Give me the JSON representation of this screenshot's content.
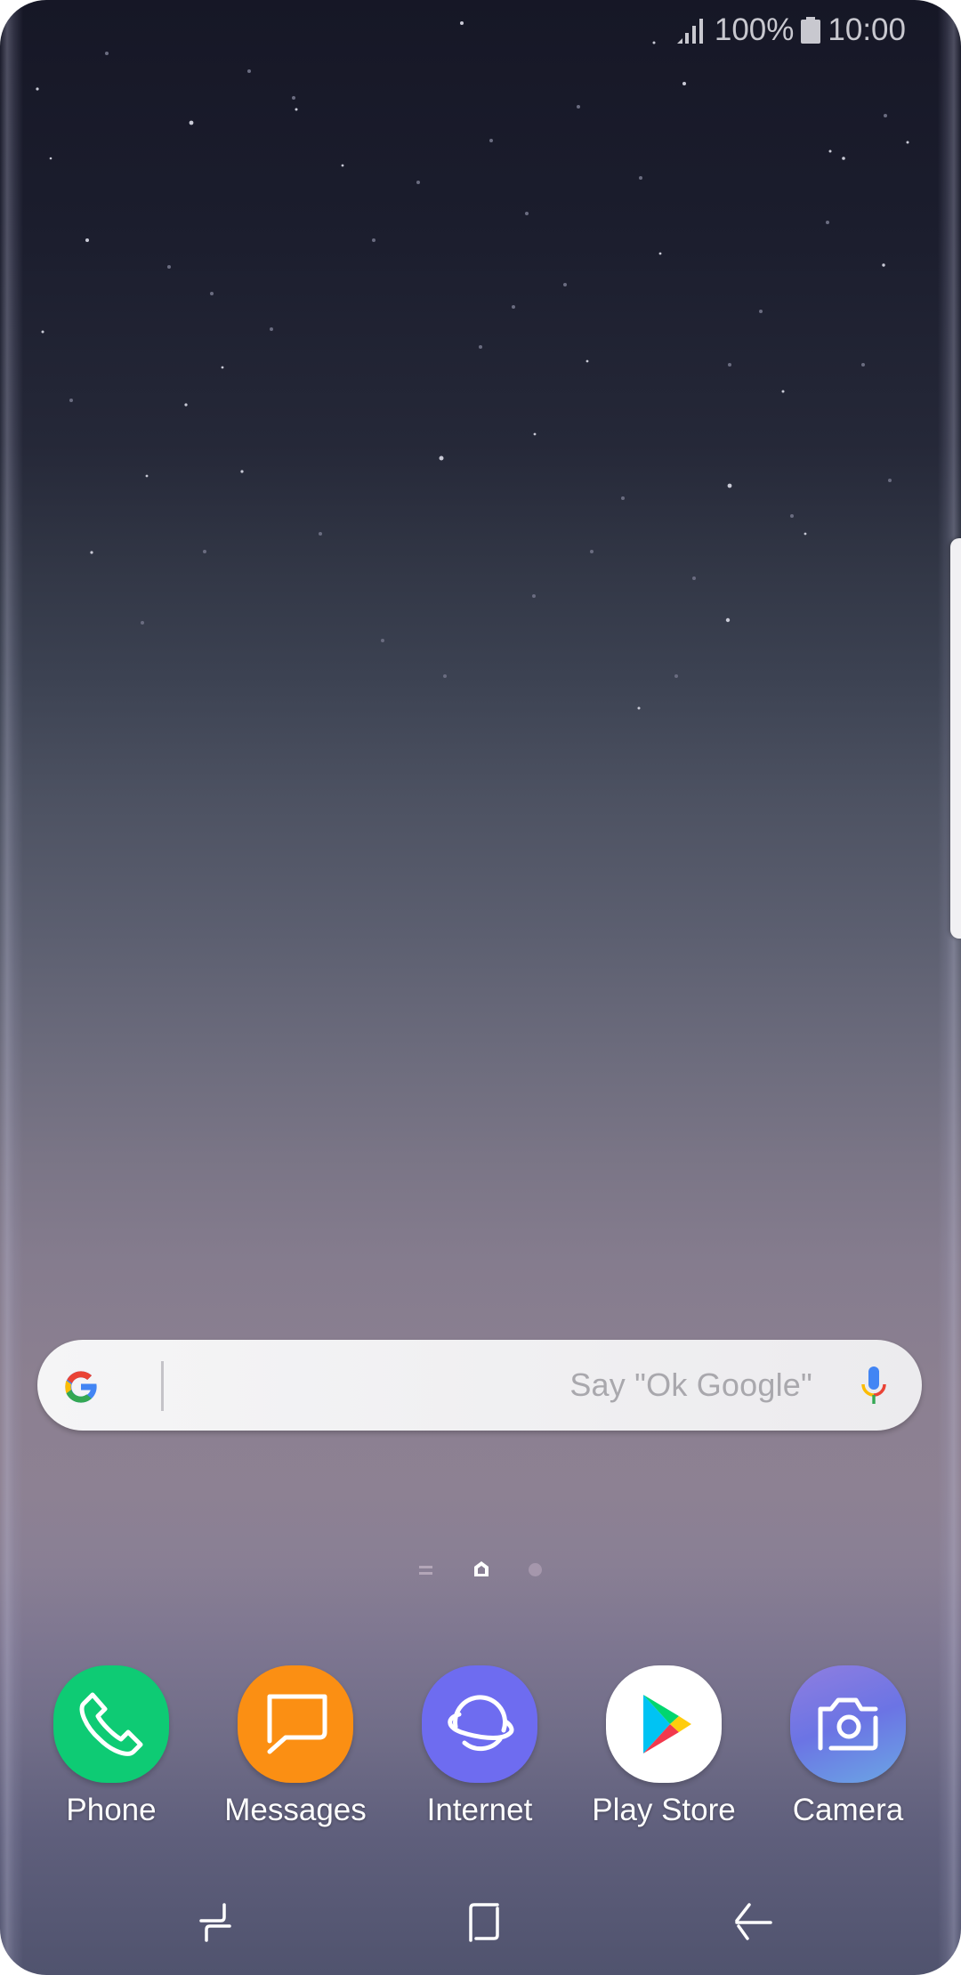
{
  "status_bar": {
    "signal_icon": "signal-strength-icon",
    "battery_percent": "100%",
    "battery_icon": "battery-icon",
    "time": "10:00"
  },
  "search_widget": {
    "logo_icon": "google-g-icon",
    "placeholder": "Say \"Ok Google\"",
    "mic_icon": "microphone-icon"
  },
  "page_indicator": {
    "items": [
      "list-page-icon",
      "home-page-icon",
      "page-dot"
    ],
    "current": "home"
  },
  "dock": {
    "apps": [
      {
        "label": "Phone",
        "icon": "phone-icon",
        "color": "#0ecb74"
      },
      {
        "label": "Messages",
        "icon": "message-bubble-icon",
        "color": "#fb8f13"
      },
      {
        "label": "Internet",
        "icon": "planet-icon",
        "color": "#6e6cf0"
      },
      {
        "label": "Play Store",
        "icon": "play-store-icon",
        "color": "#ffffff"
      },
      {
        "label": "Camera",
        "icon": "camera-icon",
        "color": "#6b78e6"
      }
    ]
  },
  "nav_bar": {
    "recents": "recents-icon",
    "home": "home-square-icon",
    "back": "back-arrow-icon"
  }
}
